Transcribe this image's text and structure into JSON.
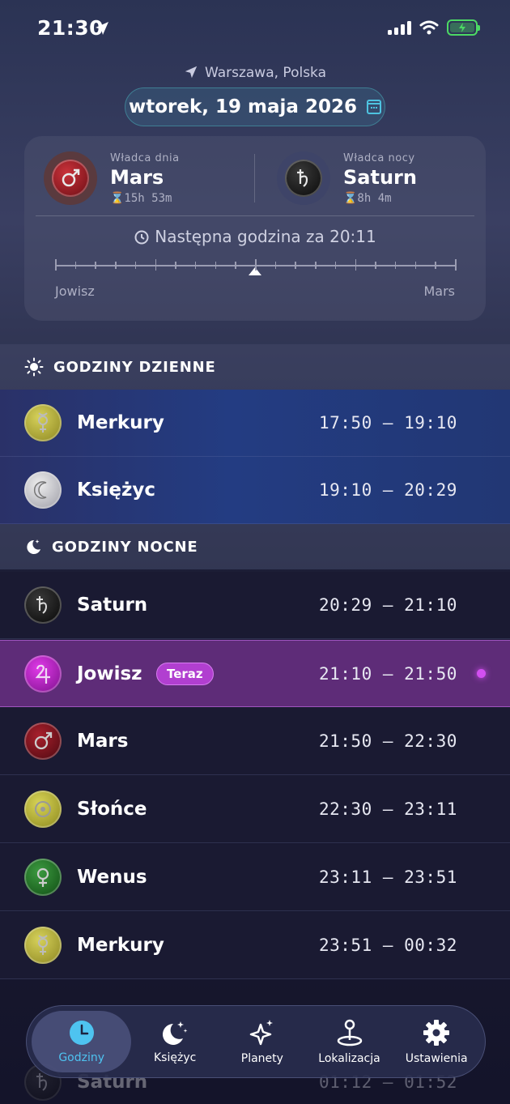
{
  "status_bar": {
    "time": "21:30"
  },
  "header": {
    "location": "Warszawa, Polska",
    "date": "wtorek, 19 maja 2026"
  },
  "rulers": {
    "day": {
      "label": "Władca dnia",
      "name": "Mars",
      "duration": "⌛15h 53m",
      "symbol": "♂"
    },
    "night": {
      "label": "Władca nocy",
      "name": "Saturn",
      "duration": "⌛8h 4m",
      "symbol": "♄"
    },
    "next_hour": "Następna godzina za 20:11",
    "timeline_start": "Jowisz",
    "timeline_end": "Mars"
  },
  "day_section": {
    "title": "GODZINY DZIENNE",
    "rows": [
      {
        "name": "Merkury",
        "time": "17:50 – 19:10",
        "symbol": "☿"
      },
      {
        "name": "Księżyc",
        "time": "19:10 – 20:29",
        "symbol": "☾"
      }
    ]
  },
  "night_section": {
    "title": "GODZINY NOCNE",
    "rows": [
      {
        "name": "Saturn",
        "time": "20:29 – 21:10",
        "symbol": "♄"
      },
      {
        "name": "Jowisz",
        "time": "21:10 – 21:50",
        "symbol": "♃",
        "badge": "Teraz"
      },
      {
        "name": "Mars",
        "time": "21:50 – 22:30",
        "symbol": "♂"
      },
      {
        "name": "Słońce",
        "time": "22:30 – 23:11",
        "symbol": "☉"
      },
      {
        "name": "Wenus",
        "time": "23:11 – 23:51",
        "symbol": "♀"
      },
      {
        "name": "Merkury",
        "time": "23:51 – 00:32",
        "symbol": "☿"
      },
      {
        "name": "Saturn",
        "time": "01:12 – 01:52",
        "symbol": "♄"
      }
    ]
  },
  "tabbar": {
    "tabs": [
      {
        "label": "Godziny",
        "icon": "clock-icon"
      },
      {
        "label": "Księżyc",
        "icon": "moon-stars-icon"
      },
      {
        "label": "Planety",
        "icon": "sparkles-icon"
      },
      {
        "label": "Lokalizacja",
        "icon": "map-pin-icon"
      },
      {
        "label": "Ustawienia",
        "icon": "gear-icon"
      }
    ],
    "active_color": "#4ec3f0"
  }
}
